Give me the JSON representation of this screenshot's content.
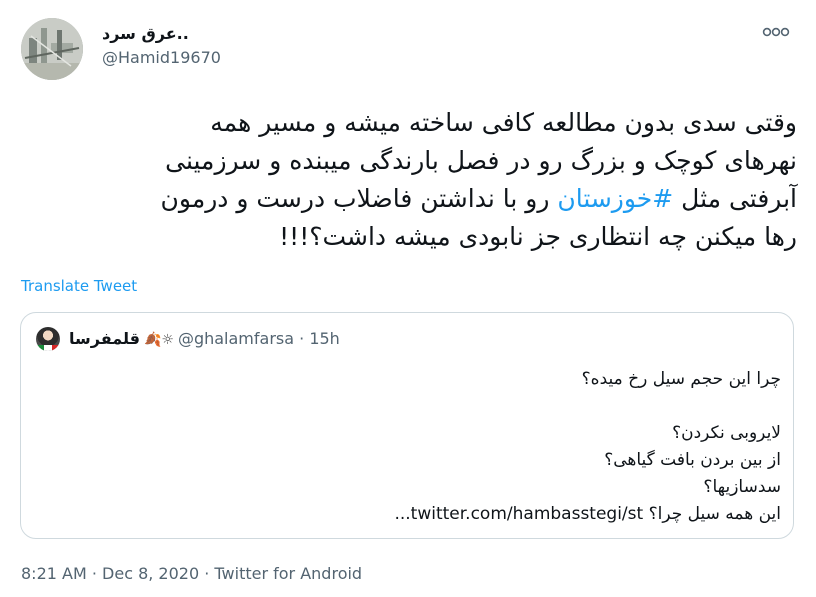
{
  "author": {
    "display_name": "عرق سرد..",
    "handle": "@Hamid19670"
  },
  "more_icon": "more-horizontal-icon",
  "tweet": {
    "lines": [
      "وقتی سدی بدون مطالعه کافی ساخته میشه و مسیر همه",
      "نهرهای کوچک و بزرگ رو در فصل بارندگی میبنده و سرزمینی",
      "",
      "رها میکنن چه انتظاری جز نابودی میشه داشت؟!!!"
    ],
    "line3_before": "آبرفتی مثل ",
    "hashtag": "#خوزستان",
    "line3_after": " رو با نداشتن فاضلاب درست و درمون"
  },
  "translate_label": "Translate Tweet",
  "quote": {
    "display_name": "قلمفرسا",
    "emoji": "🍂☼",
    "handle": "@ghalamfarsa",
    "separator": "·",
    "time": "15h",
    "lines": [
      "چرا این حجم سیل رخ میده؟",
      "",
      "لایروبی نکردن؟",
      "از بین بردن بافت گیاهی؟",
      "سدسازیها؟",
      "این همه سیل چرا؟ twitter.com/hambasstegi/st..."
    ]
  },
  "meta": {
    "time": "8:21 AM",
    "sep1": " · ",
    "date": "Dec 8, 2020",
    "sep2": " · ",
    "source": "Twitter for Android"
  },
  "colors": {
    "link": "#1d9bf0",
    "secondary_text": "#536471",
    "border": "#cfd9de"
  }
}
